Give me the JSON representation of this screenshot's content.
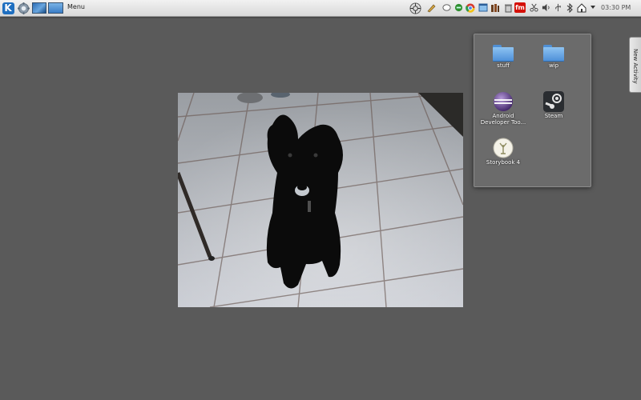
{
  "panel": {
    "menu_label": "Menu",
    "clock": "03:30 PM",
    "tray_icons": [
      "crosshair-icon",
      "pencil-icon",
      "chat-icon",
      "phone-icon",
      "chrome-icon",
      "window-icon",
      "library-icon",
      "trash-icon",
      "lastfm-icon",
      "scissors-icon",
      "volume-icon",
      "usb-icon",
      "bluetooth-icon",
      "house-icon",
      "arrow-icon"
    ],
    "lastfm_text": "fm"
  },
  "folderview": {
    "items": [
      {
        "label": "stuff",
        "icon": "folder-icon"
      },
      {
        "label": "wip",
        "icon": "folder-icon"
      },
      {
        "label": "Android Developer Too...",
        "icon": "eclipse-icon"
      },
      {
        "label": "Steam",
        "icon": "steam-icon"
      },
      {
        "label": "Storybook 4",
        "icon": "storybook-icon"
      }
    ]
  },
  "new_activity": {
    "label": "New Activity"
  },
  "colors": {
    "desktop": "#5a5a5a",
    "panel": "#e6e6e6",
    "folder": "#6b8fd4",
    "accent": "#1f6fc0"
  }
}
